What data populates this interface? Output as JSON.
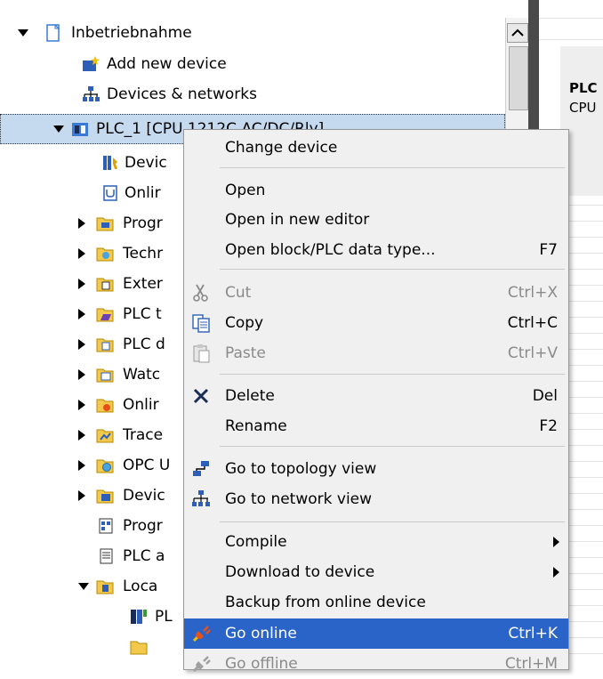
{
  "tree": {
    "items": [
      {
        "label": "Inbetriebnahme"
      },
      {
        "label": "Add new device"
      },
      {
        "label": "Devices & networks"
      },
      {
        "label": "PLC_1 [CPU 1212C AC/DC/Rly]"
      },
      {
        "label": "Devic"
      },
      {
        "label": "Onlir"
      },
      {
        "label": "Progr"
      },
      {
        "label": "Techr"
      },
      {
        "label": "Exter"
      },
      {
        "label": "PLC t"
      },
      {
        "label": "PLC d"
      },
      {
        "label": "Watc"
      },
      {
        "label": "Onlir"
      },
      {
        "label": "Trace"
      },
      {
        "label": "OPC U"
      },
      {
        "label": "Devic"
      },
      {
        "label": "Progr"
      },
      {
        "label": "PLC a"
      },
      {
        "label": "Loca"
      },
      {
        "label": "PL"
      }
    ]
  },
  "right_panel": {
    "line1": "PLC",
    "line2": "CPU"
  },
  "menu": {
    "items": [
      {
        "label": "Change device",
        "shortcut": ""
      },
      {
        "label": "Open",
        "shortcut": ""
      },
      {
        "label": "Open in new editor",
        "shortcut": ""
      },
      {
        "label": "Open block/PLC data type...",
        "shortcut": "F7"
      },
      {
        "label": "Cut",
        "shortcut": "Ctrl+X"
      },
      {
        "label": "Copy",
        "shortcut": "Ctrl+C"
      },
      {
        "label": "Paste",
        "shortcut": "Ctrl+V"
      },
      {
        "label": "Delete",
        "shortcut": "Del"
      },
      {
        "label": "Rename",
        "shortcut": "F2"
      },
      {
        "label": "Go to topology view",
        "shortcut": ""
      },
      {
        "label": "Go to network view",
        "shortcut": ""
      },
      {
        "label": "Compile",
        "shortcut": ""
      },
      {
        "label": "Download to device",
        "shortcut": ""
      },
      {
        "label": "Backup from online device",
        "shortcut": ""
      },
      {
        "label": "Go online",
        "shortcut": "Ctrl+K"
      },
      {
        "label": "Go offline",
        "shortcut": "Ctrl+M"
      }
    ]
  },
  "colors": {
    "highlight": "#2b64c8",
    "selected_row": "#c5d9ef",
    "menu_bg": "#f0f0f0"
  }
}
